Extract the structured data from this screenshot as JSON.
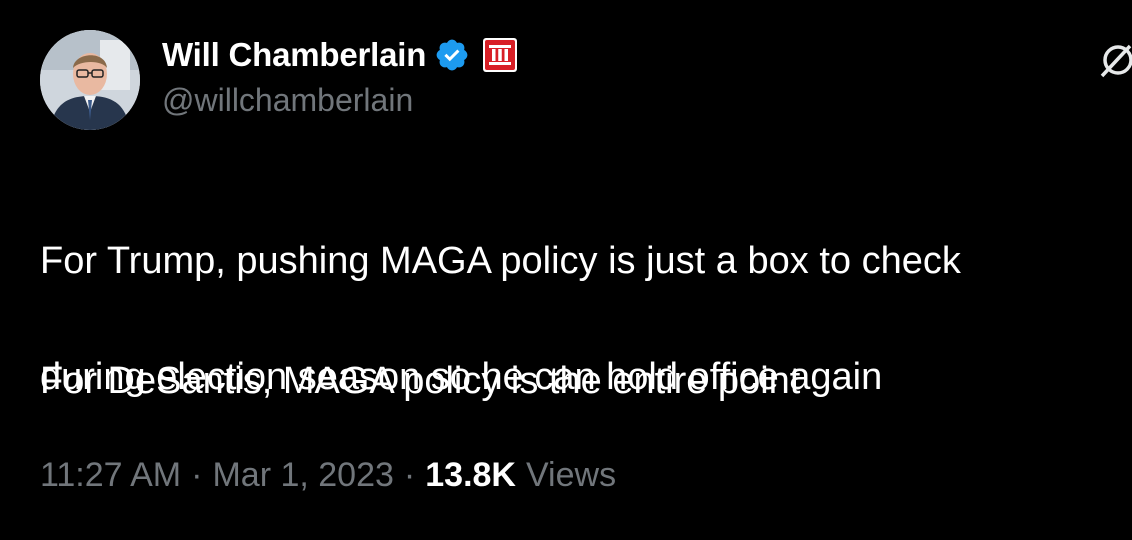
{
  "author": {
    "display_name": "Will Chamberlain",
    "handle": "@willchamberlain",
    "verified": true,
    "verified_color": "#1d9bf0",
    "affiliation_badge_color": "#d81f26"
  },
  "tweet": {
    "line1": "For Trump, pushing MAGA policy is just a box to check",
    "line2": "during election season so he can hold office again",
    "paragraph2": "For DeSantis, MAGA policy is the entire point"
  },
  "meta": {
    "time": "11:27 AM",
    "separator": "·",
    "date": "Mar 1, 2023",
    "views_count": "13.8K",
    "views_label": "Views"
  },
  "icons": {
    "top_right": "grok-icon"
  }
}
